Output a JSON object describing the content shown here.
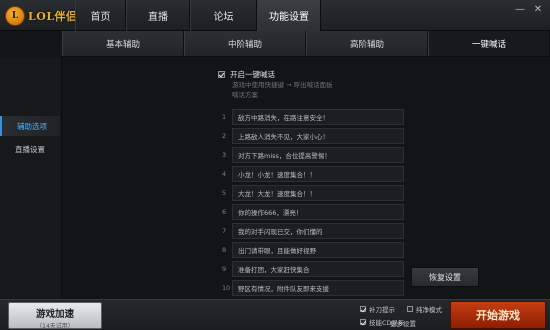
{
  "app": {
    "logo_mark": "L",
    "logo_text": "LOL伴侣"
  },
  "nav": {
    "items": [
      {
        "label": "首页"
      },
      {
        "label": "直播"
      },
      {
        "label": "论坛"
      },
      {
        "label": "功能设置"
      }
    ],
    "active_index": 3
  },
  "window": {
    "minimize": "—",
    "close": "✕"
  },
  "subtabs": {
    "items": [
      {
        "label": "基本辅助"
      },
      {
        "label": "中阶辅助"
      },
      {
        "label": "高阶辅助"
      },
      {
        "label": "一键喊话"
      }
    ],
    "active_index": 3
  },
  "sidebar": {
    "items": [
      {
        "label": "辅助选项"
      },
      {
        "label": "直播设置"
      }
    ],
    "active_index": 0
  },
  "quick_chat": {
    "enable_label": "开启一键喊话",
    "enabled": true,
    "description_line1": "游戏中使用快捷键 → 呼出喊话面板",
    "description_line2": "喊话方案",
    "messages": [
      {
        "num": "1",
        "text": "敌方中路消失，在路注意安全！"
      },
      {
        "num": "2",
        "text": "上路敌人消失不见，大家小心！"
      },
      {
        "num": "3",
        "text": "对方下路miss，合位提高警惕！"
      },
      {
        "num": "4",
        "text": "小龙！小龙！速度集合！！"
      },
      {
        "num": "5",
        "text": "大龙！大龙！速度集合！！"
      },
      {
        "num": "6",
        "text": "你的操作666，漂亮！"
      },
      {
        "num": "7",
        "text": "我的对手闪现已交，你们懂的"
      },
      {
        "num": "8",
        "text": "出门请带眼，且能做好视野"
      },
      {
        "num": "9",
        "text": "准备打团，大家赶快集合"
      },
      {
        "num": "10",
        "text": "野区有情况，附件队友即来支援"
      }
    ],
    "reset_label": "恢复设置"
  },
  "bottom": {
    "accelerate_label": "游戏加速",
    "accelerate_sub": "（14天试用）",
    "options": [
      {
        "label": "补刀提示",
        "checked": true
      },
      {
        "label": "纯净模式",
        "checked": false
      },
      {
        "label": "技能CD显示",
        "checked": true
      }
    ],
    "more_settings": "更多设置",
    "start_label": "开始游戏"
  },
  "colors": {
    "accent_blue": "#4fb0ff",
    "start_red": "#c63d12",
    "logo_gold": "#e8b030"
  }
}
